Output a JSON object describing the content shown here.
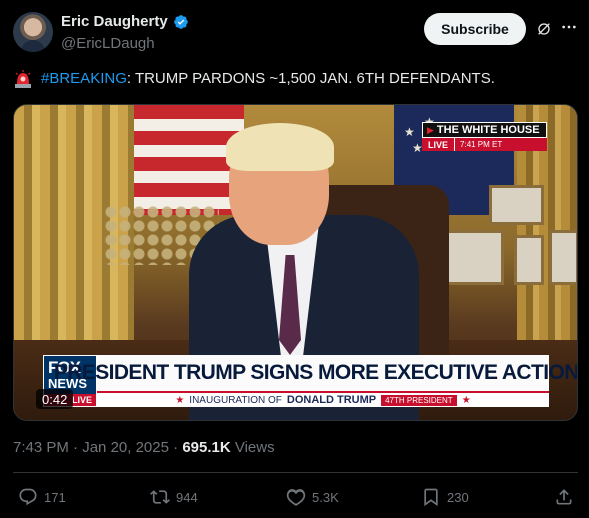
{
  "author": {
    "display_name": "Eric Daugherty",
    "handle": "@EricLDaugh",
    "verified": true
  },
  "header": {
    "subscribe_label": "Subscribe",
    "icons": [
      "grok-icon",
      "more-icon"
    ]
  },
  "tweet": {
    "emoji": "rotating-light-icon",
    "hashtag": "#BREAKING",
    "text": ": TRUMP PARDONS ~1,500 JAN. 6TH DEFENDANTS."
  },
  "media": {
    "duration": "0:42",
    "wh_bug": {
      "title": "THE WHITE HOUSE",
      "live": "LIVE",
      "time": "7:41 PM ET"
    },
    "chyron": {
      "logo_top": "FOX",
      "logo_mid": "NEWS",
      "logo_live": "LIVE",
      "headline": "PRESIDENT TRUMP SIGNS MORE EXECUTIVE ACTIONS",
      "sub_prefix": "INAUGURATION OF",
      "sub_name": "DONALD TRUMP",
      "sub_badge": "47TH PRESIDENT"
    }
  },
  "meta": {
    "time": "7:43 PM",
    "date": "Jan 20, 2025",
    "views_count": "695.1K",
    "views_label": "Views"
  },
  "actions": {
    "replies": "171",
    "reposts": "944",
    "likes": "5.3K",
    "bookmarks": "230"
  },
  "colors": {
    "background": "#000000",
    "accent": "#1d9bf0",
    "muted": "#71767b",
    "text": "#e7e9ea"
  }
}
